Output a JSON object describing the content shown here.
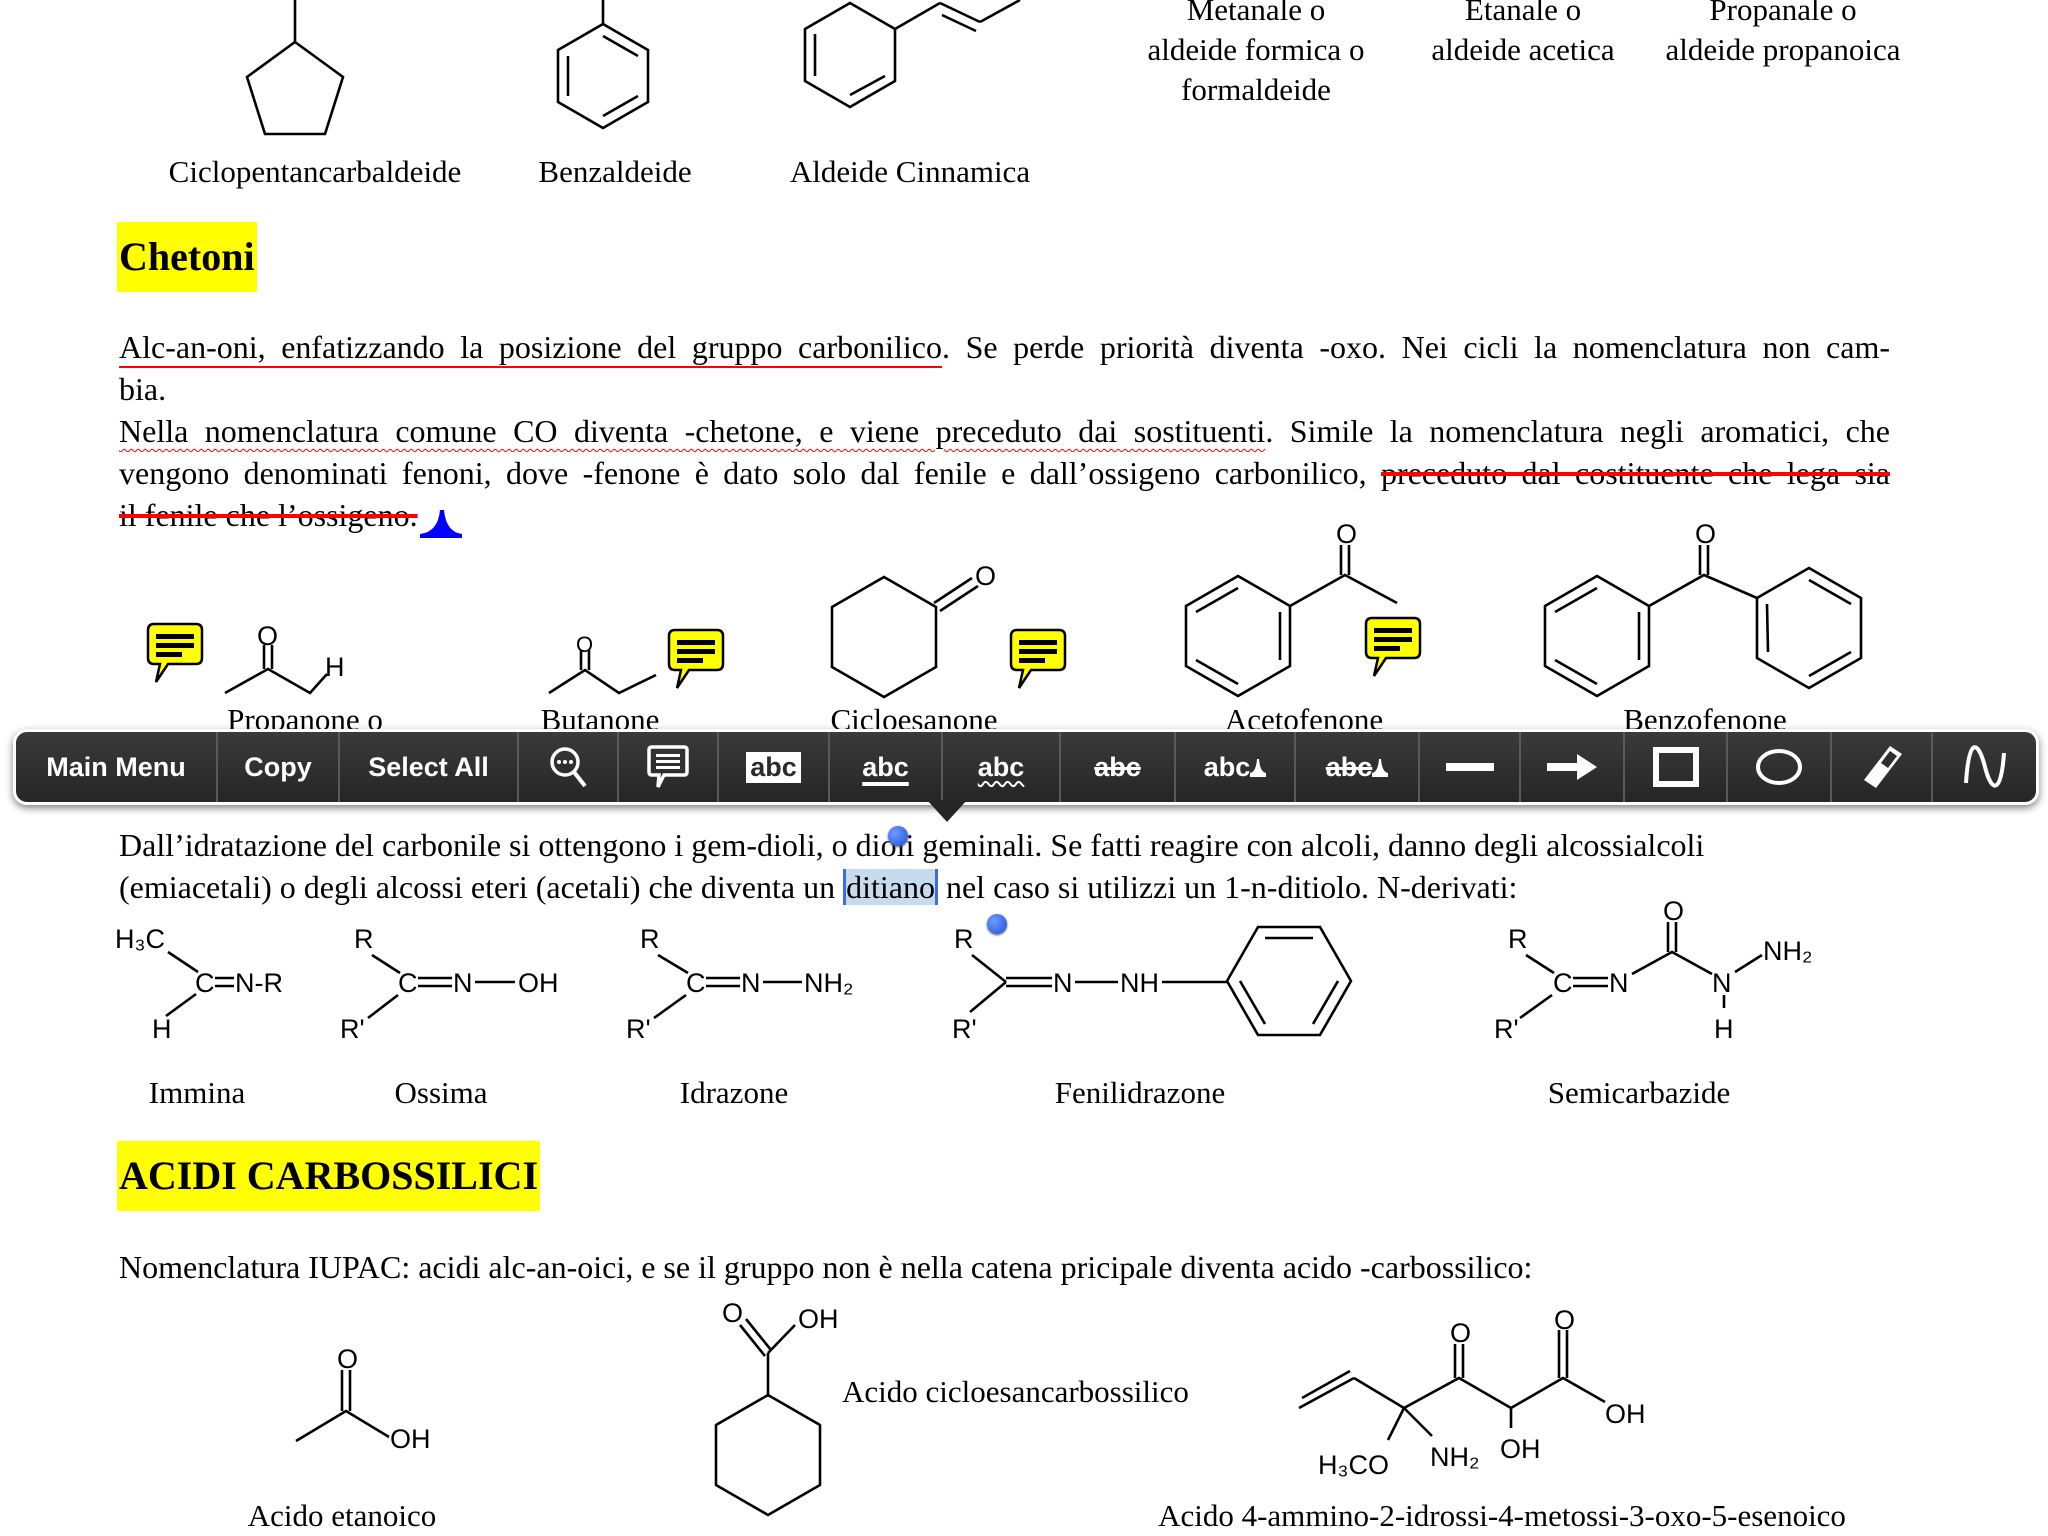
{
  "top_labels": {
    "ciclopentancarbaldeide": "Ciclopentancarbaldeide",
    "benzaldeide": "Benzaldeide",
    "aldeide_cinnamica": "Aldeide Cinnamica",
    "metanale": [
      "Metanale o",
      "aldeide formica o",
      "formaldeide"
    ],
    "etanale": [
      "Etanale o",
      "aldeide acetica"
    ],
    "propanale": [
      "Propanale o",
      "aldeide propanoica"
    ]
  },
  "chetoni": {
    "heading": "Chetoni",
    "p1_underlined": "Alc-an-oni, enfatizzando la posizione del gruppo carbonilico",
    "p1_rest": ". Se perde priorità diventa -oxo. Nei cicli la nomenclatura non cam-",
    "p1_line2": "bia.",
    "p2_wavy": "Nella nomenclatura comune CO diventa -chetone, e viene preceduto dai sostituenti",
    "p2_rest": ". Simile la nomenclatura negli aromatici, che",
    "p2_line2": "vengono denominati fenoni, dove -fenone è dato solo dal fenile e dall’ossigeno carbonilico, ",
    "p2_line2_strike": "preceduto dal costituente che lega sia",
    "p2_line3_strike": "il fenile che l’ossigeno.",
    "molecules": [
      "Propanone o",
      "Butanone",
      "Cicloesanone",
      "Acetofenone",
      "Benzofenone"
    ]
  },
  "atoms": {
    "O": "O",
    "H": "H",
    "R": "R",
    "R_prime": "R'",
    "H3C": "H₃C",
    "C": "C",
    "N": "N",
    "N_R": "N-R",
    "OH": "OH",
    "NH2": "NH₂",
    "NH": "NH",
    "H3CO": "H₃CO"
  },
  "toolbar": {
    "main_menu": "Main Menu",
    "copy": "Copy",
    "select_all": "Select All",
    "abc": "abc",
    "icons": [
      "search-icon",
      "comment-icon",
      "highlight-icon",
      "underline-icon",
      "squiggly-icon",
      "strikeout-icon",
      "insert-text-icon",
      "replace-text-icon",
      "line-icon",
      "arrow-icon",
      "rectangle-icon",
      "ellipse-icon",
      "eraser-icon",
      "freehand-icon"
    ]
  },
  "derivati": {
    "line1": "Dall’idratazione del carbonile si ottengono i gem-dioli, o dioli geminali. Se fatti reagire con alcoli, danno degli alcossialcoli",
    "line2_pre": "(emiacetali) o degli alcossi eteri (acetali) che diventa un ",
    "line2_selected": "ditiano",
    "line2_post": " nel caso si utilizzi un 1-n-ditiolo. N-derivati:",
    "names": [
      "Immina",
      "Ossima",
      "Idrazone",
      "Fenilidrazone",
      "Semicarbazide"
    ]
  },
  "acidi": {
    "heading": "ACIDI CARBOSSILICI",
    "text": "Nomenclatura IUPAC: acidi alc-an-oici, e se il gruppo non è nella catena pricipale diventa acido -carbossilico:",
    "names": [
      "Acido etanoico",
      "Acido cicloesancarbossilico",
      "Acido 4-ammino-2-idrossi-4-metossi-3-oxo-5-esenoico"
    ]
  },
  "colors": {
    "highlight": "#ffff00",
    "annotation_red": "#ff0000",
    "selection": "#c7dbef",
    "handle_blue": "#1a4fd6",
    "toolbar_bg": "#2e2e2e"
  }
}
